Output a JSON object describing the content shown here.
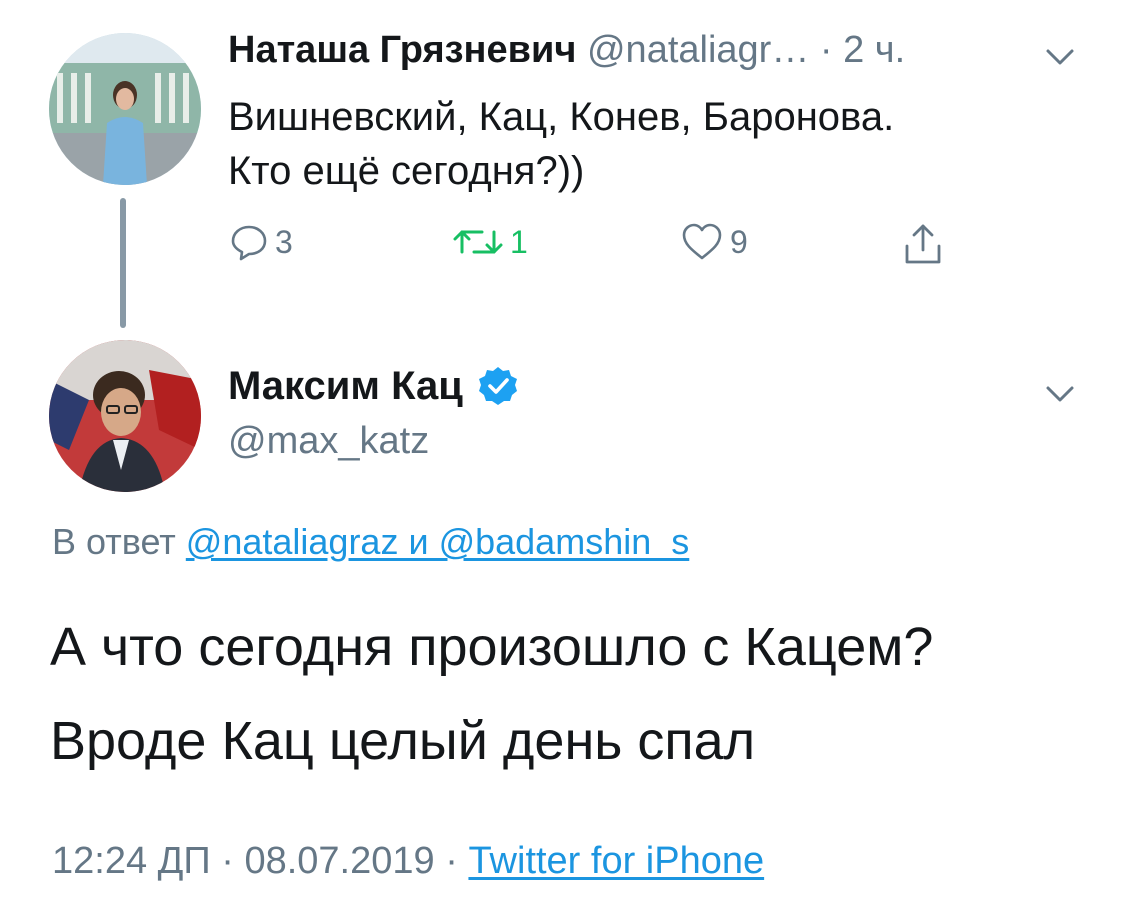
{
  "parent_tweet": {
    "name": "Наташа Грязневич",
    "handle": "@nataliagr…",
    "time": "· 2 ч.",
    "text_line1": "Вишневский, Кац, Конев, Баронова.",
    "text_line2": "Кто ещё сегодня?))",
    "actions": {
      "reply_icon": "comment-icon",
      "reply_count": "3",
      "retweet_icon": "retweet-icon",
      "retweet_count": "1",
      "like_icon": "heart-icon",
      "like_count": "9",
      "share_icon": "share-icon"
    }
  },
  "reply_tweet": {
    "name": "Максим Кац",
    "verified_icon": "verified-badge-icon",
    "handle": "@max_katz",
    "replying_prefix": "В ответ",
    "replying_to": "@nataliagraz и @badamshin_s",
    "text_line1": "А что сегодня произошло с Кацем?",
    "text_line2": "Вроде Кац целый день спал",
    "timestamp": "12:24 ДП · 08.07.2019 ·",
    "source": "Twitter for iPhone"
  },
  "colors": {
    "accent": "#1b95e0",
    "secondary_text": "#657786",
    "retweet_green": "#17bf63",
    "thread_line": "#8899a6"
  }
}
